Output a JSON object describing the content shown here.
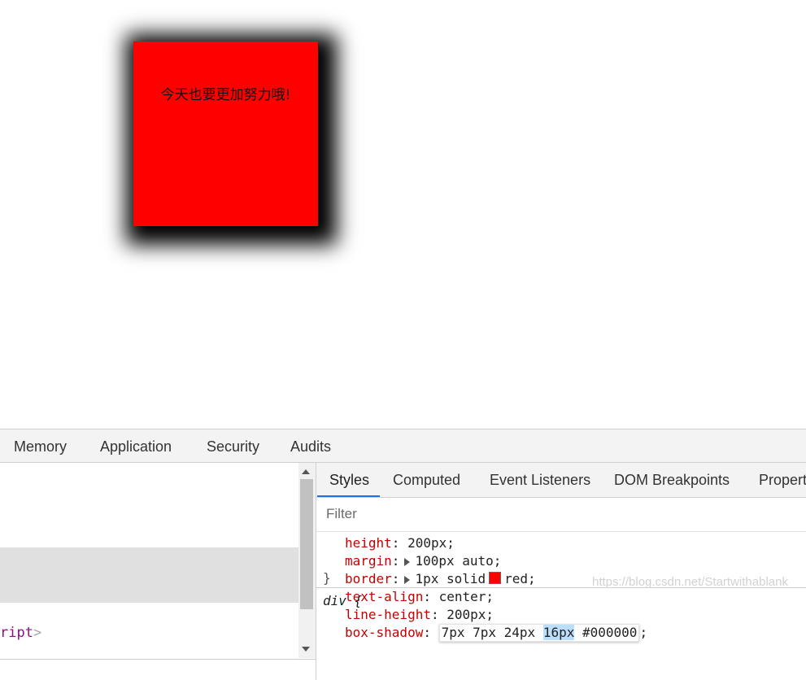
{
  "preview": {
    "box_text": "今天也要更加努力哦!",
    "box_color": "#ff0000",
    "shadow_color": "#000000"
  },
  "devtools": {
    "main_tabs": [
      "Memory",
      "Application",
      "Security",
      "Audits"
    ],
    "dom": {
      "partial_tag": "ript",
      "close_bracket": ">"
    },
    "styles": {
      "tabs": [
        "Styles",
        "Computed",
        "Event Listeners",
        "DOM Breakpoints",
        "Propert"
      ],
      "active_tab": "Styles",
      "filter_placeholder": "Filter",
      "declarations": [
        {
          "prop": "height",
          "value": "200px;"
        },
        {
          "prop": "margin",
          "value": "100px auto;"
        },
        {
          "prop": "border",
          "value_pre": "1px solid",
          "value_post": "red;"
        },
        {
          "prop": "text-align",
          "value": "center;"
        },
        {
          "prop": "line-height",
          "value": "200px;"
        },
        {
          "prop": "box-shadow",
          "value_a": "7px 7px 24px",
          "value_sel": "16px",
          "value_b": "#000000",
          "value_end": ";"
        }
      ],
      "rule_close": "}",
      "next_selector": "div {",
      "swatch_color": "#ff0000"
    },
    "watermark": "https://blog.csdn.net/Startwithablank"
  }
}
